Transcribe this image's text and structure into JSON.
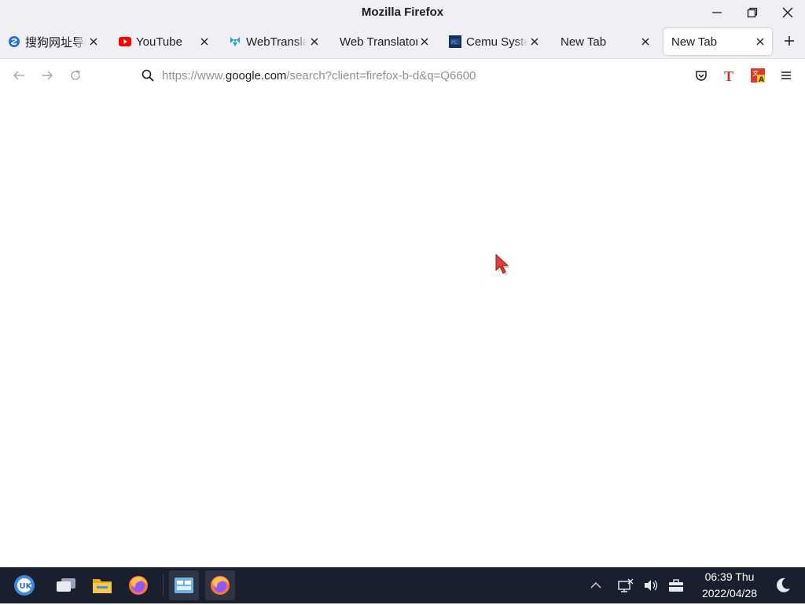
{
  "window": {
    "title": "Mozilla Firefox"
  },
  "tabs": [
    {
      "label": "搜狗网址导航",
      "favicon": "sogou-icon",
      "selected": false
    },
    {
      "label": "YouTube",
      "favicon": "youtube-icon",
      "selected": false
    },
    {
      "label": "WebTranslator",
      "favicon": "webtranslator-icon",
      "selected": false
    },
    {
      "label": "Web Translator",
      "favicon": "",
      "selected": false
    },
    {
      "label": "Cemu System",
      "favicon": "cemu-icon",
      "selected": false
    },
    {
      "label": "New Tab",
      "favicon": "",
      "selected": false
    },
    {
      "label": "New Tab",
      "favicon": "",
      "selected": true
    }
  ],
  "navbar": {
    "url_prefix": "https://www.",
    "url_domain": "google.com",
    "url_suffix": "/search?client=firefox-b-d&q=Q6600"
  },
  "taskbar": {
    "clock_time": "06:39 Thu",
    "clock_date": "2022/04/28"
  },
  "colors": {
    "chrome_bg": "#f0f0f4",
    "taskbar_bg": "#1a1f2e",
    "youtube_red": "#ff0000",
    "cursor_red": "#e0403a"
  }
}
